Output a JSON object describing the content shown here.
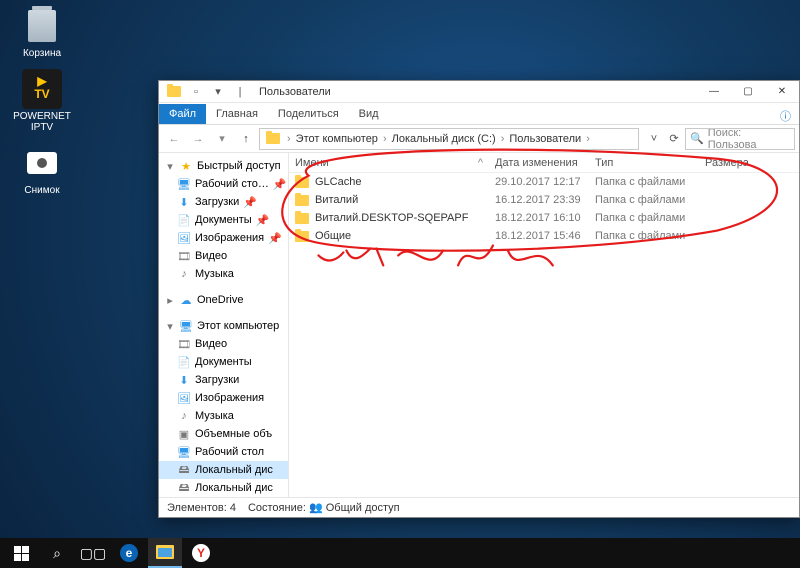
{
  "desktop": {
    "recycle": "Корзина",
    "iptv": "POWERNET IPTV",
    "snapshot": "Снимок"
  },
  "window": {
    "title": "Пользователи",
    "tabs": {
      "file": "Файл",
      "home": "Главная",
      "share": "Поделиться",
      "view": "Вид"
    },
    "breadcrumb": {
      "root": "Этот компьютер",
      "drive": "Локальный диск (C:)",
      "folder": "Пользователи"
    },
    "search_placeholder": "Поиск: Пользова",
    "columns": {
      "name": "Имени",
      "date": "Дата изменения",
      "type": "Тип",
      "size": "Размера"
    },
    "rows": [
      {
        "name": "GLCache",
        "date": "29.10.2017 12:17",
        "type": "Папка с файлами"
      },
      {
        "name": "Виталий",
        "date": "16.12.2017 23:39",
        "type": "Папка с файлами"
      },
      {
        "name": "Виталий.DESKTOP-SQEPAPF",
        "date": "18.12.2017 16:10",
        "type": "Папка с файлами"
      },
      {
        "name": "Общие",
        "date": "18.12.2017 15:46",
        "type": "Папка с файлами"
      }
    ],
    "tree": {
      "quick": "Быстрый доступ",
      "desk": "Рабочий сто…",
      "down": "Загрузки",
      "docs": "Документы",
      "pics": "Изображения",
      "vid": "Видео",
      "mus": "Музыка",
      "onedrive": "OneDrive",
      "pc": "Этот компьютер",
      "pc_vid": "Видео",
      "pc_docs": "Документы",
      "pc_down": "Загрузки",
      "pc_pics": "Изображения",
      "pc_mus": "Музыка",
      "pc_vol": "Объемные объ",
      "pc_desk": "Рабочий стол",
      "pc_drive": "Локальный дис",
      "pc_drive2": "Локальный дис"
    },
    "status": {
      "count": "Элементов: 4",
      "state": "Состояние:",
      "shared": "Общий доступ"
    }
  }
}
